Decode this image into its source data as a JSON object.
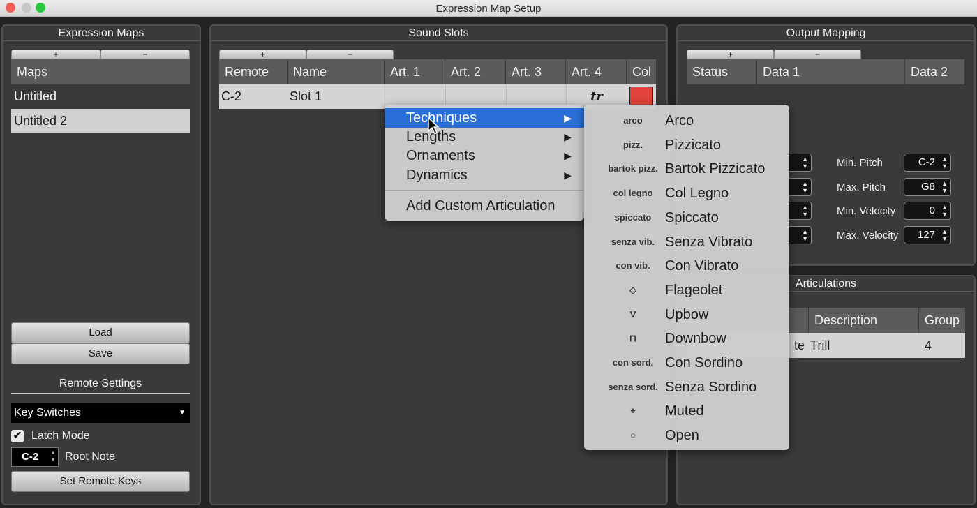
{
  "window": {
    "title": "Expression Map Setup"
  },
  "expression_maps": {
    "title": "Expression Maps",
    "plus": "+",
    "minus": "−",
    "header": "Maps",
    "items": [
      "Untitled",
      "Untitled 2"
    ],
    "load_label": "Load",
    "save_label": "Save"
  },
  "remote_settings": {
    "title": "Remote Settings",
    "mode_value": "Key Switches",
    "latch_label": "Latch Mode",
    "latch_checked": true,
    "root_note_value": "C-2",
    "root_note_label": "Root Note",
    "set_keys_label": "Set Remote Keys"
  },
  "sound_slots": {
    "title": "Sound Slots",
    "plus": "+",
    "minus": "−",
    "columns": [
      "Remote",
      "Name",
      "Art. 1",
      "Art. 2",
      "Art. 3",
      "Art. 4",
      "Col"
    ],
    "rows": [
      {
        "remote": "C-2",
        "name": "Slot 1",
        "art4": "tr",
        "color": "#e0433a"
      }
    ]
  },
  "output_mapping": {
    "title": "Output Mapping",
    "plus": "+",
    "minus": "−",
    "columns": [
      "Status",
      "Data 1",
      "Data 2"
    ],
    "fields": [
      {
        "label": "Min. Pitch",
        "value": "C-2"
      },
      {
        "label": "Max. Pitch",
        "value": "G8"
      },
      {
        "label": "Min. Velocity",
        "value": "0"
      },
      {
        "label": "Max. Velocity",
        "value": "127"
      }
    ]
  },
  "articulations": {
    "title": "Articulations",
    "columns": [
      "Description",
      "Group"
    ],
    "rows": [
      {
        "partial": "te",
        "description": "Trill",
        "group": "4"
      }
    ]
  },
  "context_menu": {
    "items": [
      "Techniques",
      "Lengths",
      "Ornaments",
      "Dynamics"
    ],
    "custom": "Add Custom Articulation",
    "arrow": "▶"
  },
  "submenu": {
    "items": [
      {
        "abbr": "arco",
        "label": "Arco"
      },
      {
        "abbr": "pizz.",
        "label": "Pizzicato"
      },
      {
        "abbr": "bartok pizz.",
        "label": "Bartok Pizzicato"
      },
      {
        "abbr": "col legno",
        "label": "Col Legno"
      },
      {
        "abbr": "spiccato",
        "label": "Spiccato"
      },
      {
        "abbr": "senza vib.",
        "label": "Senza Vibrato"
      },
      {
        "abbr": "con vib.",
        "label": "Con Vibrato"
      },
      {
        "abbr": "◇",
        "label": "Flageolet"
      },
      {
        "abbr": "V",
        "label": "Upbow"
      },
      {
        "abbr": "⊓",
        "label": "Downbow"
      },
      {
        "abbr": "con sord.",
        "label": "Con Sordino"
      },
      {
        "abbr": "senza sord.",
        "label": "Senza Sordino"
      },
      {
        "abbr": "+",
        "label": "Muted"
      },
      {
        "abbr": "○",
        "label": "Open"
      }
    ]
  }
}
